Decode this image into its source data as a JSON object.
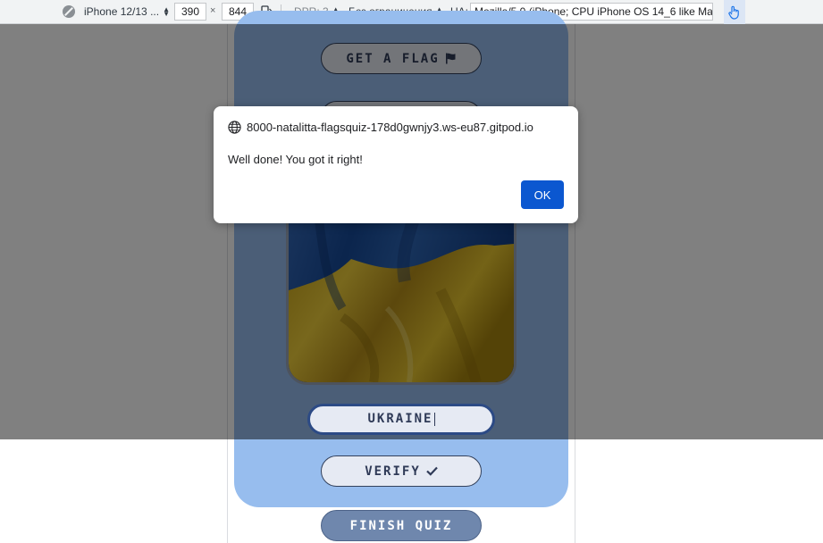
{
  "devtools": {
    "device": "iPhone 12/13 ...",
    "width": "390",
    "times": "×",
    "height": "844",
    "dpr": "DPR: 3",
    "throttle": "Без ограничения",
    "ua_label": "UA:",
    "ua_value": "Mozilla/5.0 (iPhone; CPU iPhone OS 14_6 like Mac"
  },
  "quiz": {
    "get_flag_label": "GET A FLAG",
    "answer_value": "UKRAINE",
    "verify_label": "VERIFY",
    "finish_label": "FINISH QUIZ"
  },
  "alert": {
    "origin": "8000-natalitta-flagsquiz-178d0gwnjy3.ws-eu87.gitpod.io",
    "message": "Well done! You got it right!",
    "ok_label": "OK"
  },
  "colors": {
    "card": "#97bdee",
    "button_text": "#2f3a57",
    "flag_blue": "#1f4f9e",
    "flag_yellow": "#e6c020",
    "dialog_ok": "#0b57d0"
  },
  "icons": {
    "get_flag": "flag-icon",
    "verify": "check-icon",
    "origin": "globe-icon",
    "touch": "touch-hand-icon"
  }
}
